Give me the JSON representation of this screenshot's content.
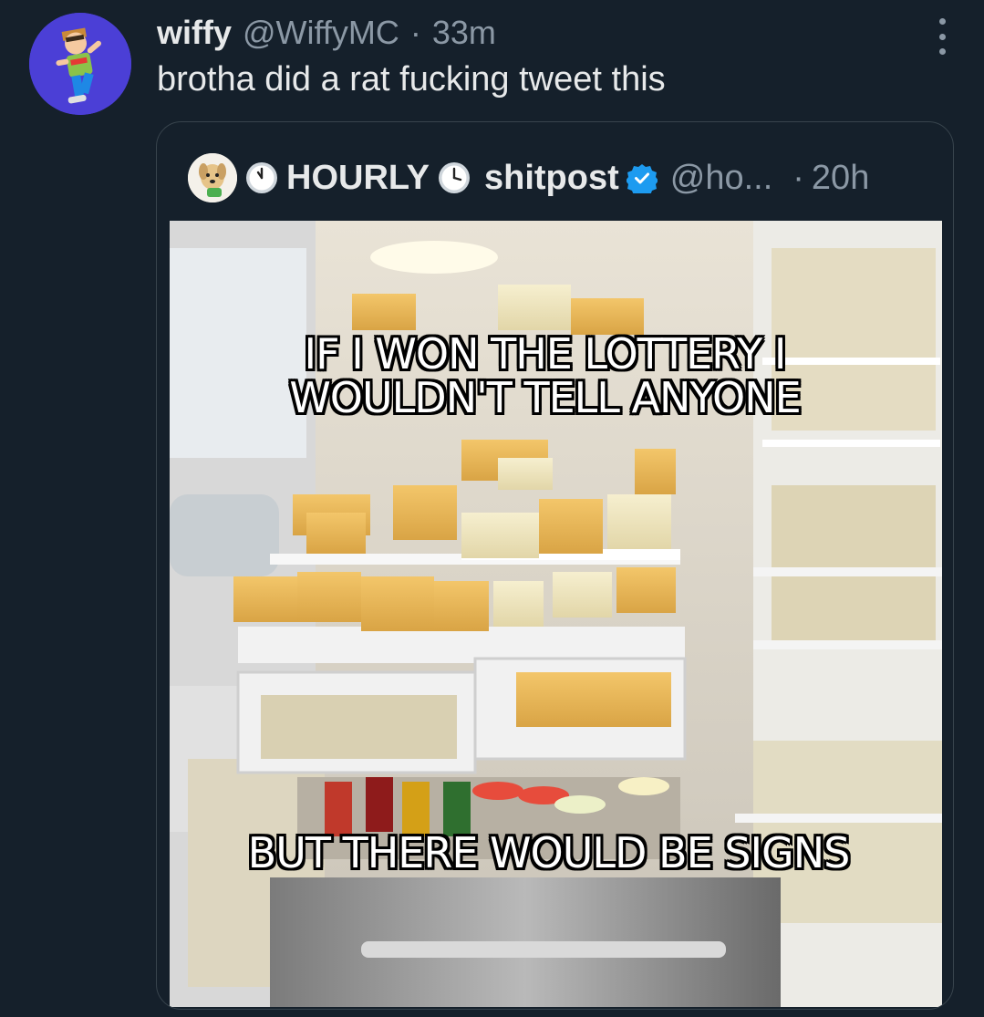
{
  "tweet": {
    "author_name": "wiffy",
    "handle": "@WiffyMC",
    "separator": "·",
    "time": "33m",
    "text": "brotha did a rat fucking tweet this"
  },
  "quote": {
    "author_name": "HOURLY",
    "author_name_suffix": "shitpost",
    "handle": "@ho...",
    "separator": "·",
    "time": "20h",
    "media": {
      "caption_top_line1": "IF I WON THE LOTTERY I",
      "caption_top_line2": "WOULDN'T TELL ANYONE",
      "caption_bottom": "BUT THERE WOULD BE SIGNS"
    }
  },
  "colors": {
    "background": "#15202b",
    "text_primary": "#e7e9ea",
    "text_secondary": "#8b98a5",
    "border": "#38444d",
    "verified": "#1d9bf0",
    "avatar_bg": "#4b3fd6"
  },
  "icons": {
    "more": "more-dots-icon",
    "clock": "clock-icon",
    "verified": "verified-badge-icon"
  }
}
